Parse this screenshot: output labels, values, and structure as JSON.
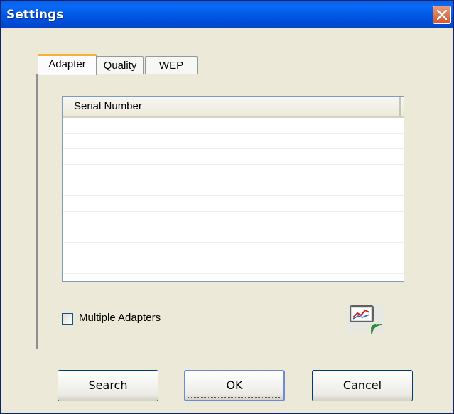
{
  "window": {
    "title": "Settings"
  },
  "tabs": [
    {
      "label": "Adapter",
      "active": true
    },
    {
      "label": "Quality",
      "active": false
    },
    {
      "label": "WEP",
      "active": false
    }
  ],
  "adapter_list": {
    "columns": [
      "Serial Number"
    ],
    "rows": []
  },
  "multiple_adapters": {
    "label": "Multiple Adapters",
    "checked": false
  },
  "buttons": {
    "search": "Search",
    "ok": "OK",
    "cancel": "Cancel"
  },
  "icons": {
    "close": "close-icon",
    "adapter": "wireless-adapter-icon"
  },
  "colors": {
    "titlebar": "#0058e6",
    "dialog_bg": "#ece9d8",
    "active_tab_accent": "#f5b03b",
    "close_button": "#d4552d"
  }
}
